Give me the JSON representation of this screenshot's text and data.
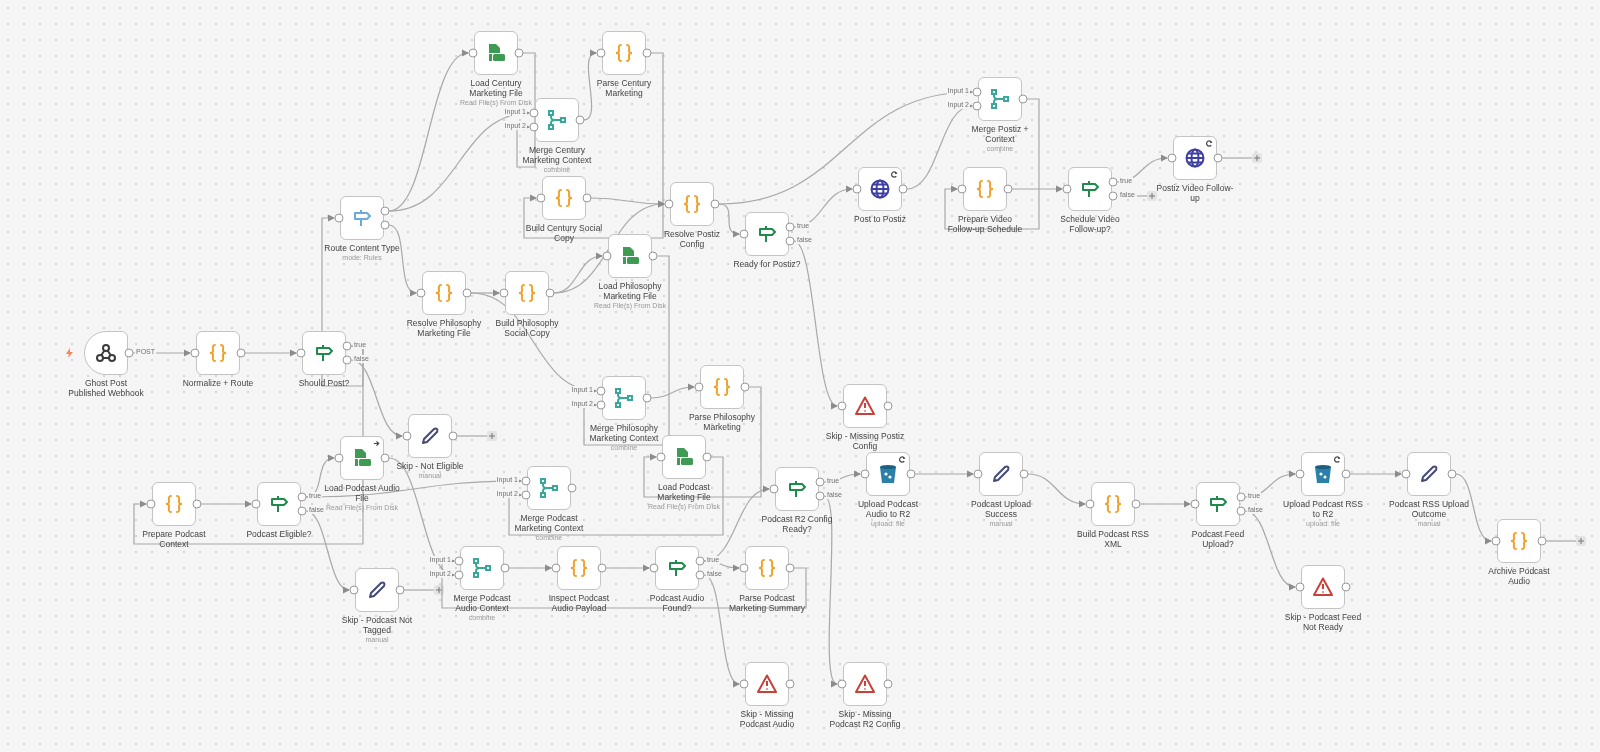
{
  "canvas": {
    "nodes": [
      {
        "kind": "webhook",
        "label": "Ghost Post Published Webhook",
        "outputs": [
          "POST"
        ]
      },
      {
        "kind": "code",
        "label": "Normalize + Route"
      },
      {
        "kind": "switch",
        "label": "Should Post?",
        "outputs": [
          "true",
          "false"
        ]
      },
      {
        "kind": "route",
        "label": "Route Content Type",
        "subtitle": "mode: Rules"
      },
      {
        "kind": "readfile",
        "label": "Load Century Marketing File",
        "subtitle": "Read File(s) From Disk"
      },
      {
        "kind": "code",
        "label": "Parse Century Marketing"
      },
      {
        "kind": "merge",
        "label": "Merge Century Marketing Context",
        "subtitle": "combine",
        "inputs": [
          "Input 1",
          "Input 2"
        ]
      },
      {
        "kind": "code",
        "label": "Build Century Social Copy"
      },
      {
        "kind": "code",
        "label": "Resolve Postiz Config"
      },
      {
        "kind": "switch",
        "label": "Ready for Postiz?",
        "outputs": [
          "true",
          "false"
        ]
      },
      {
        "kind": "http",
        "label": "Post to Postiz",
        "refresh_icon": true
      },
      {
        "kind": "merge",
        "label": "Merge Postiz + Context",
        "subtitle": "combine",
        "inputs": [
          "Input 1",
          "Input 2"
        ]
      },
      {
        "kind": "code",
        "label": "Prepare Video Follow-up Schedule"
      },
      {
        "kind": "switch",
        "label": "Schedule Video Follow-up?",
        "outputs": [
          "true",
          "false"
        ]
      },
      {
        "kind": "http",
        "label": "Postiz Video Follow-up",
        "refresh_icon": true
      },
      {
        "kind": "code",
        "label": "Resolve Philosophy Marketing File"
      },
      {
        "kind": "code",
        "label": "Build Philosophy Social Copy"
      },
      {
        "kind": "readfile",
        "label": "Load Philosophy Marketing File",
        "subtitle": "Read File(s) From Disk"
      },
      {
        "kind": "merge",
        "label": "Merge Philosophy Marketing Context",
        "subtitle": "combine",
        "inputs": [
          "Input 1",
          "Input 2"
        ]
      },
      {
        "kind": "code",
        "label": "Parse Philosophy Marketing"
      },
      {
        "kind": "warning",
        "label": "Skip - Missing Postiz Config"
      },
      {
        "kind": "code",
        "label": "Prepare Podcast Context"
      },
      {
        "kind": "switch",
        "label": "Podcast Eligible?",
        "outputs": [
          "true",
          "false"
        ]
      },
      {
        "kind": "readfile",
        "label": "Load Podcast Audio File",
        "subtitle": "Read File(s) From Disk",
        "arrow_icon": true
      },
      {
        "kind": "edit",
        "label": "Skip - Not Eligible",
        "subtitle": "manual"
      },
      {
        "kind": "edit",
        "label": "Skip - Podcast Not Tagged",
        "subtitle": "manual"
      },
      {
        "kind": "merge",
        "label": "Merge Podcast Audio Context",
        "subtitle": "combine",
        "inputs": [
          "Input 1",
          "Input 2"
        ]
      },
      {
        "kind": "merge",
        "label": "Merge Podcast Marketing Context",
        "subtitle": "combine",
        "inputs": [
          "Input 1",
          "Input 2"
        ]
      },
      {
        "kind": "readfile",
        "label": "Load Podcast Marketing File",
        "subtitle": "Read File(s) From Disk"
      },
      {
        "kind": "code",
        "label": "Inspect Podcast Audio Payload"
      },
      {
        "kind": "switch",
        "label": "Podcast Audio Found?",
        "outputs": [
          "true",
          "false"
        ]
      },
      {
        "kind": "code",
        "label": "Parse Podcast Marketing Summary"
      },
      {
        "kind": "switch",
        "label": "Podcast R2 Config Ready?",
        "outputs": [
          "true",
          "false"
        ]
      },
      {
        "kind": "bucket",
        "label": "Upload Podcast Audio to R2",
        "subtitle": "upload: file",
        "refresh_icon": true
      },
      {
        "kind": "edit",
        "label": "Podcast Upload Success",
        "subtitle": "manual"
      },
      {
        "kind": "warning",
        "label": "Skip - Missing Podcast Audio"
      },
      {
        "kind": "warning",
        "label": "Skip - Missing Podcast R2 Config"
      },
      {
        "kind": "code",
        "label": "Build Podcast RSS XML"
      },
      {
        "kind": "switch",
        "label": "Podcast Feed Upload?",
        "outputs": [
          "true",
          "false"
        ]
      },
      {
        "kind": "bucket",
        "label": "Upload Podcast RSS to R2",
        "subtitle": "upload: file",
        "refresh_icon": true
      },
      {
        "kind": "edit",
        "label": "Podcast RSS Upload Outcome",
        "subtitle": "manual"
      },
      {
        "kind": "warning",
        "label": "Skip - Podcast Feed Not Ready"
      },
      {
        "kind": "code",
        "label": "Archive Podcast Audio"
      }
    ]
  }
}
